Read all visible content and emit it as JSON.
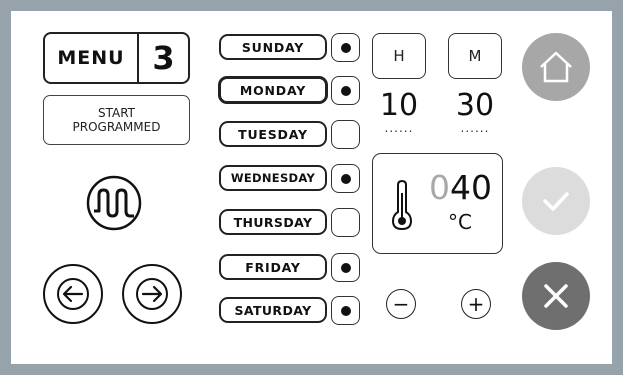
{
  "menu": {
    "label": "MENU",
    "number": "3"
  },
  "start_button": {
    "label": "START\nPROGRAMMED"
  },
  "days": [
    {
      "label": "SUNDAY",
      "checked": true,
      "selected": false
    },
    {
      "label": "MONDAY",
      "checked": true,
      "selected": true
    },
    {
      "label": "TUESDAY",
      "checked": false,
      "selected": false
    },
    {
      "label": "WEDNESDAY",
      "checked": true,
      "selected": false
    },
    {
      "label": "THURSDAY",
      "checked": false,
      "selected": false
    },
    {
      "label": "FRIDAY",
      "checked": true,
      "selected": false
    },
    {
      "label": "SATURDAY",
      "checked": true,
      "selected": false
    }
  ],
  "time": {
    "hour_label": "H",
    "minute_label": "M",
    "hour": "10",
    "minute": "30",
    "hour_underline": "......",
    "minute_underline": "......"
  },
  "temperature": {
    "leading_digit": "0",
    "value": "40",
    "unit": "°C"
  },
  "adjust": {
    "minus": "−",
    "plus": "+"
  },
  "icons": {
    "heating": "heating-element-icon",
    "thermometer": "thermometer-icon",
    "home": "home-icon",
    "confirm": "checkmark-icon",
    "cancel": "close-icon",
    "prev": "arrow-left-icon",
    "next": "arrow-right-icon"
  },
  "colors": {
    "frame": "#96a3ab",
    "home_button": "#a7a7a7",
    "confirm_button": "#dcdcdc",
    "cancel_button": "#6f6f6f"
  }
}
